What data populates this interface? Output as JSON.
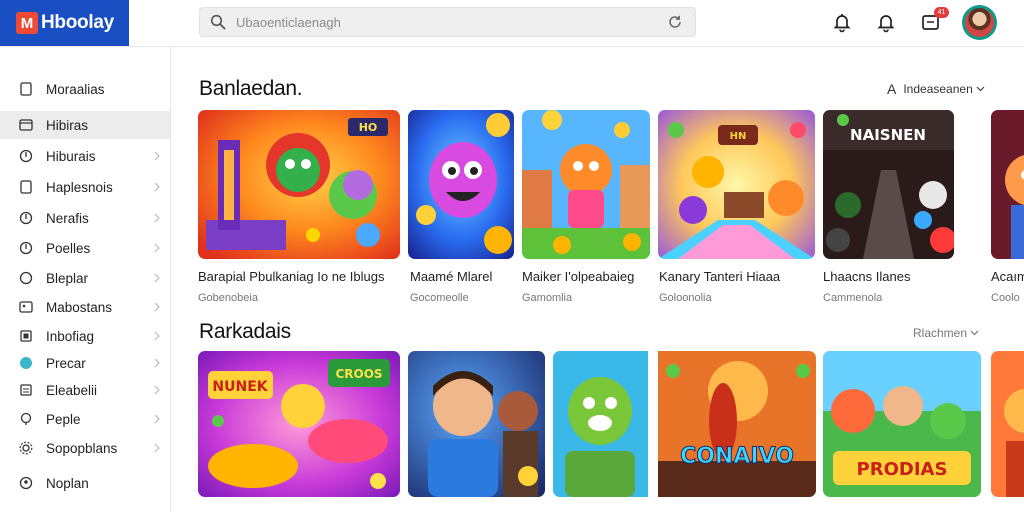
{
  "app": {
    "logo_mark": "M",
    "logo_text": "Hboolay"
  },
  "search": {
    "placeholder": "Ubaoenticlaenagh"
  },
  "header": {
    "badge_count": "41"
  },
  "sidebar": {
    "items": [
      {
        "label": "Moraalias",
        "icon": "file-icon",
        "chevron": false
      },
      {
        "label": "Hibiras",
        "icon": "folder-icon",
        "chevron": false
      },
      {
        "label": "Hiburais",
        "icon": "globe-icon",
        "chevron": true
      },
      {
        "label": "Haplesnois",
        "icon": "file-icon",
        "chevron": true
      },
      {
        "label": "Nerafis",
        "icon": "globe-icon",
        "chevron": true
      },
      {
        "label": "Poelles",
        "icon": "globe-icon",
        "chevron": true
      },
      {
        "label": "Bleplar",
        "icon": "circle-icon",
        "chevron": true
      },
      {
        "label": "Mabostans",
        "icon": "image-icon",
        "chevron": true
      },
      {
        "label": "Inbofiag",
        "icon": "square-icon",
        "chevron": true
      },
      {
        "label": "Precar",
        "icon": "dot-icon",
        "chevron": true
      },
      {
        "label": "Eleabelii",
        "icon": "list-icon",
        "chevron": true
      },
      {
        "label": "Peple",
        "icon": "pin-icon",
        "chevron": true
      },
      {
        "label": "Sopopblans",
        "icon": "gear-icon",
        "chevron": true
      },
      {
        "label": "Noplan",
        "icon": "user-icon",
        "chevron": false
      }
    ]
  },
  "sections": [
    {
      "title": "Banlaedan.",
      "filter_prefix": "A",
      "filter_label": "Indeaseanen",
      "cards": [
        {
          "title": "Barapial Pbulkaniag Io ne Iblugs",
          "subtitle": "Gobenobeia"
        },
        {
          "title": "Maamé Mlarel",
          "subtitle": "Gocomeolle"
        },
        {
          "title": "Maiker I'olpeabaieg",
          "subtitle": "Gamomlia"
        },
        {
          "title": "Kanary Tanteri Hiaaa",
          "subtitle": "Goloonolia"
        },
        {
          "title": "Lhaacns Ilanes",
          "subtitle": "Cammenola"
        },
        {
          "title": "Acaım",
          "subtitle": "Coolo"
        }
      ]
    },
    {
      "title": "Rarkadais",
      "filter_prefix": "",
      "filter_label": "Rlachmen",
      "cards": [
        {
          "title": "",
          "subtitle": ""
        },
        {
          "title": "",
          "subtitle": ""
        },
        {
          "title": "",
          "subtitle": ""
        },
        {
          "title": "",
          "subtitle": ""
        },
        {
          "title": "",
          "subtitle": ""
        },
        {
          "title": "",
          "subtitle": ""
        }
      ]
    }
  ],
  "artwork": {
    "row1_card1": "HO",
    "row1_card4": "HN",
    "row1_card5": "NAISNEN",
    "row2_card1_a": "NUNEK",
    "row2_card1_b": "CROOS",
    "row2_card4": "CONAIVO",
    "row2_card5": "PRODIAS"
  },
  "colors": {
    "brand": "#1a4fc4",
    "logo_accent": "#ef4a36",
    "active_item": "#ececec",
    "avatar_ring": "#0e9a8a",
    "badge": "#e43c3c"
  }
}
